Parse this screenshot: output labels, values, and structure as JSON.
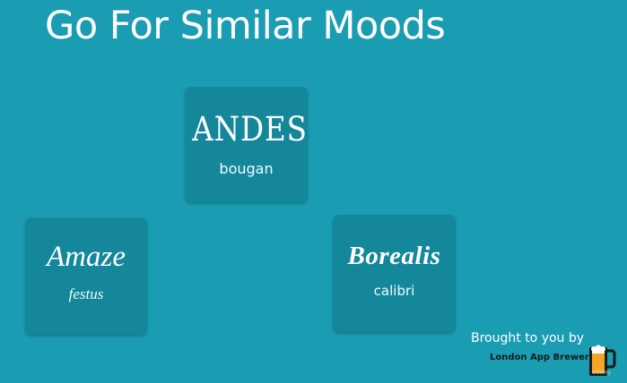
{
  "slide": {
    "title": "Go For Similar Moods",
    "background": "#1a9cb3",
    "card_color": "#14879b"
  },
  "cards": [
    {
      "sample": "ANDES",
      "font_name": "bougan"
    },
    {
      "sample": "Amaze",
      "font_name": "festus"
    },
    {
      "sample": "Borealis",
      "font_name": "calibri"
    }
  ],
  "credit": {
    "brought_by": "Brought to you by",
    "brewery": "London App Brewery",
    "logo_icon": "beer-mug-icon",
    "watermark": "Udemy"
  }
}
